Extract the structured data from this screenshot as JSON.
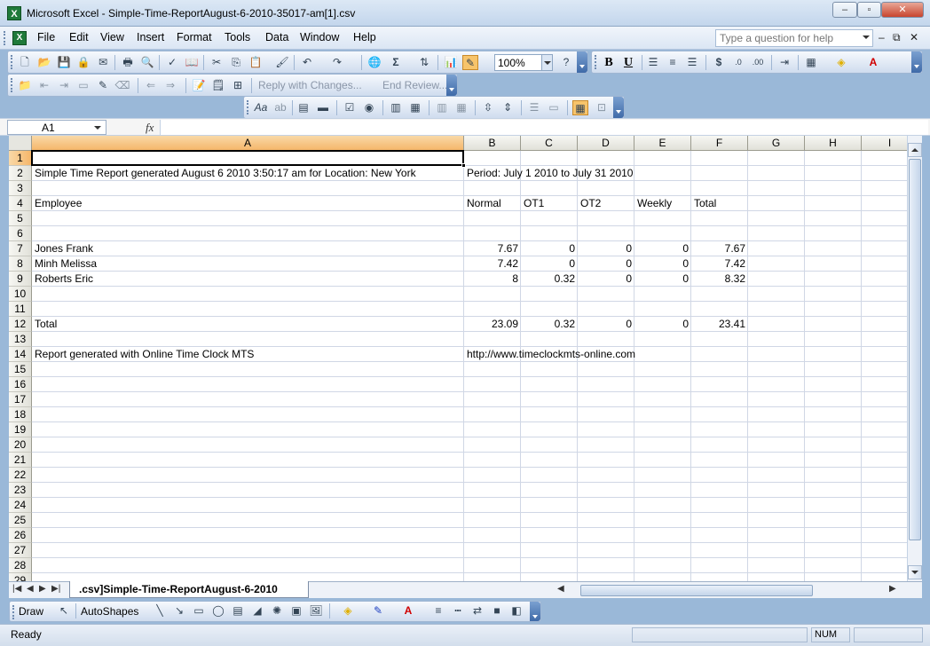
{
  "window": {
    "title": "Microsoft Excel - Simple-Time-ReportAugust-6-2010-35017-am[1].csv",
    "min_label": "–",
    "max_label": "▫",
    "close_label": "✕"
  },
  "menu": {
    "items": [
      "File",
      "Edit",
      "View",
      "Insert",
      "Format",
      "Tools",
      "Data",
      "Window",
      "Help"
    ],
    "help_placeholder": "Type a question for help"
  },
  "toolbar": {
    "zoom": "100%",
    "reply_label": "Reply with Changes...",
    "end_review_label": "End Review..."
  },
  "formula_bar": {
    "name_box": "A1",
    "fx_label": "fx",
    "formula": ""
  },
  "sheet": {
    "columns": [
      "A",
      "B",
      "C",
      "D",
      "E",
      "F",
      "G",
      "H",
      "I"
    ],
    "rows": [
      "1",
      "2",
      "3",
      "4",
      "5",
      "6",
      "7",
      "8",
      "9",
      "10",
      "11",
      "12",
      "13",
      "14",
      "15",
      "16",
      "17",
      "18",
      "19",
      "20",
      "21",
      "22",
      "23",
      "24",
      "25",
      "26",
      "27",
      "28",
      "29"
    ],
    "cells": {
      "A2": "Simple Time Report generated August 6 2010 3:50:17 am for Location: New York",
      "B2": "Period: July 1 2010 to July 31 2010",
      "A4": "Employee",
      "B4": "Normal",
      "C4": "OT1",
      "D4": "OT2",
      "E4": "Weekly",
      "F4": "Total",
      "A7": "Jones  Frank",
      "B7": "7.67",
      "C7": "0",
      "D7": "0",
      "E7": "0",
      "F7": "7.67",
      "A8": "Minh  Melissa",
      "B8": "7.42",
      "C8": "0",
      "D8": "0",
      "E8": "0",
      "F8": "7.42",
      "A9": "Roberts  Eric",
      "B9": "8",
      "C9": "0.32",
      "D9": "0",
      "E9": "0",
      "F9": "8.32",
      "A12": "Total",
      "B12": "23.09",
      "C12": "0.32",
      "D12": "0",
      "E12": "0",
      "F12": "23.41",
      "A14": "Report generated with Online Time Clock MTS",
      "B14": "http://www.timeclockmts-online.com"
    }
  },
  "tabs": {
    "active_sheet": ".csv]Simple-Time-ReportAugust-6-2010"
  },
  "drawing": {
    "draw_label": "Draw",
    "autoshapes_label": "AutoShapes"
  },
  "status": {
    "text": "Ready",
    "num": "NUM"
  }
}
